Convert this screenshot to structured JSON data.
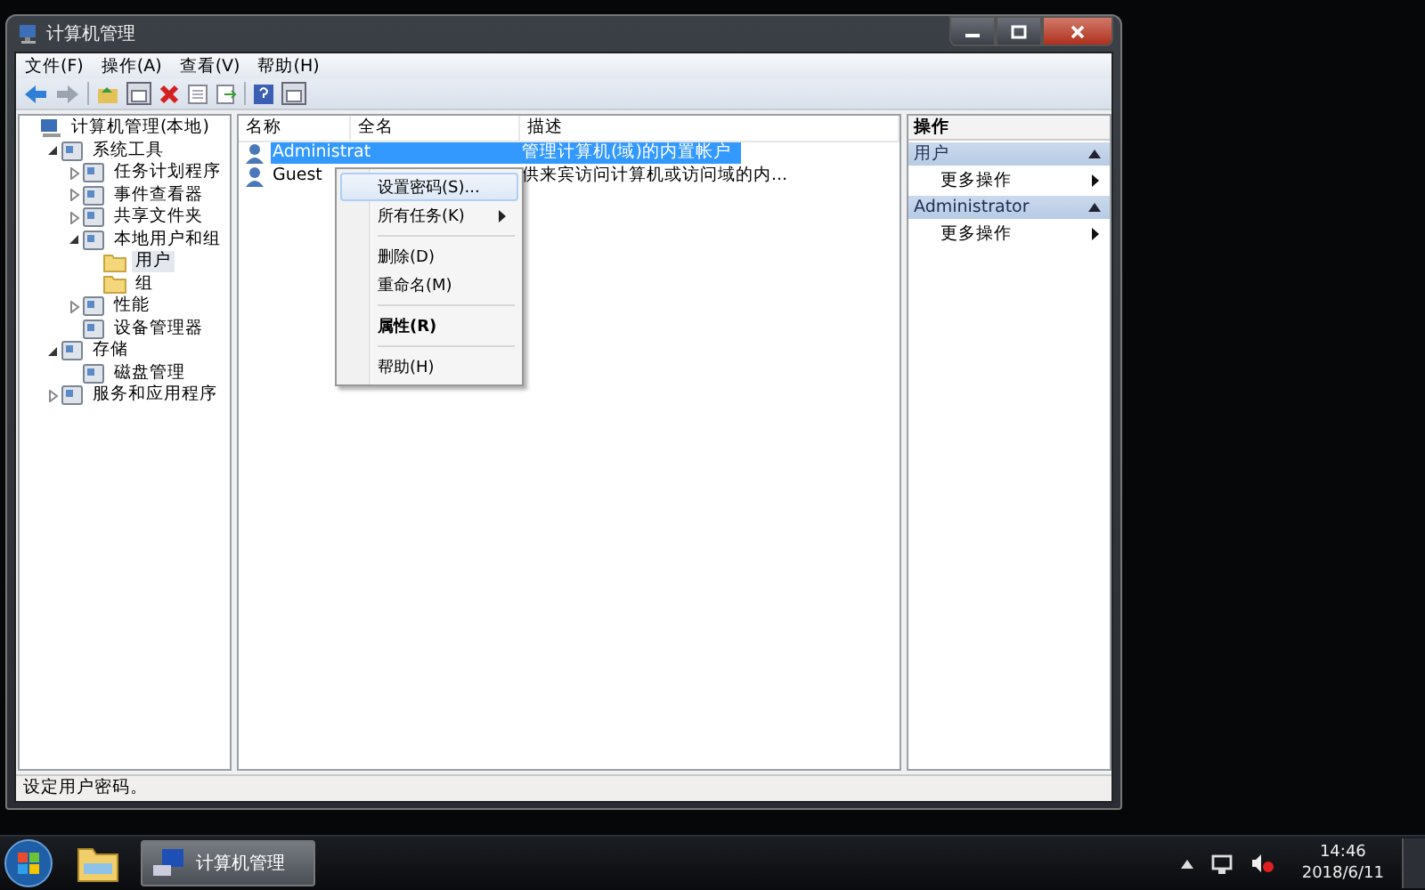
{
  "window": {
    "title": "计算机管理"
  },
  "menu_bar": [
    "文件(F)",
    "操作(A)",
    "查看(V)",
    "帮助(H)"
  ],
  "tree": [
    {
      "label": "计算机管理(本地)",
      "selected": false,
      "children": [
        {
          "label": "系统工具",
          "selected": false,
          "expanded": true,
          "children": [
            {
              "label": "任务计划程序",
              "selected": false,
              "expanded": false
            },
            {
              "label": "事件查看器",
              "selected": false,
              "expanded": false
            },
            {
              "label": "共享文件夹",
              "selected": false,
              "expanded": false
            },
            {
              "label": "本地用户和组",
              "selected": false,
              "expanded": true,
              "children": [
                {
                  "label": "用户",
                  "selected": true
                },
                {
                  "label": "组",
                  "selected": false
                }
              ]
            },
            {
              "label": "性能",
              "selected": false,
              "expanded": false
            },
            {
              "label": "设备管理器",
              "selected": false
            }
          ]
        },
        {
          "label": "存储",
          "selected": false,
          "expanded": true,
          "children": [
            {
              "label": "磁盘管理",
              "selected": false
            }
          ]
        },
        {
          "label": "服务和应用程序",
          "selected": false,
          "expanded": false
        }
      ]
    }
  ],
  "table": {
    "columns": [
      "名称",
      "全名",
      "描述"
    ],
    "rows": [
      {
        "name": "Administrat",
        "description": "管理计算机(域)的内置帐户",
        "selected": true
      },
      {
        "name": "Guest",
        "description": "供来宾访问计算机或访问域的内...",
        "selected": false
      }
    ]
  },
  "context_menu": [
    {
      "kind": "item",
      "label": "设置密码(S)...",
      "selected": true,
      "submenu": false,
      "default": false
    },
    {
      "kind": "item",
      "label": "所有任务(K)",
      "selected": false,
      "submenu": true,
      "default": false
    },
    {
      "kind": "separator"
    },
    {
      "kind": "item",
      "label": "删除(D)",
      "selected": false,
      "submenu": false,
      "default": false
    },
    {
      "kind": "item",
      "label": "重命名(M)",
      "selected": false,
      "submenu": false,
      "default": false
    },
    {
      "kind": "separator"
    },
    {
      "kind": "item",
      "label": "属性(R)",
      "selected": false,
      "submenu": false,
      "default": true
    },
    {
      "kind": "separator"
    },
    {
      "kind": "item",
      "label": "帮助(H)",
      "selected": false,
      "submenu": false,
      "default": false
    }
  ],
  "actions": {
    "title": "操作",
    "sections": [
      {
        "title": "用户",
        "expanded": true,
        "items": [
          {
            "label": "更多操作",
            "submenu": true
          }
        ]
      },
      {
        "title": "Administrator",
        "expanded": true,
        "items": [
          {
            "label": "更多操作",
            "submenu": true
          }
        ]
      }
    ]
  },
  "status_bar": "设定用户密码。",
  "taskbar": {
    "tasks": [
      {
        "label": "计算机管理",
        "selected": true
      }
    ],
    "time": "14:46",
    "date": "2018/6/11"
  }
}
